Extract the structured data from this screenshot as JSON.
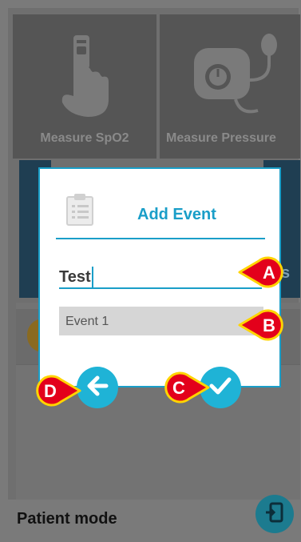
{
  "background": {
    "tiles": [
      {
        "label": "Measure SpO2",
        "icon": "finger-pulse-oximeter-icon"
      },
      {
        "label": "Measure Pressure",
        "icon": "blood-pressure-cuff-icon"
      }
    ],
    "partial_text": "s",
    "bottom_bar": {
      "label": "Patient mode",
      "icon": "exit-door-icon"
    }
  },
  "dialog": {
    "title": "Add Event",
    "icon": "clipboard-checklist-icon",
    "name_input": {
      "value": "Test"
    },
    "event_field": {
      "value": "Event 1"
    }
  },
  "actions": {
    "back_icon": "arrow-left-icon",
    "confirm_icon": "checkmark-icon"
  },
  "callouts": {
    "a": "A",
    "b": "B",
    "c": "C",
    "d": "D"
  },
  "colors": {
    "accent": "#1a9ec8",
    "button": "#1fb3d6",
    "callout_fill": "#e3001b",
    "callout_stroke": "#ffd400"
  }
}
